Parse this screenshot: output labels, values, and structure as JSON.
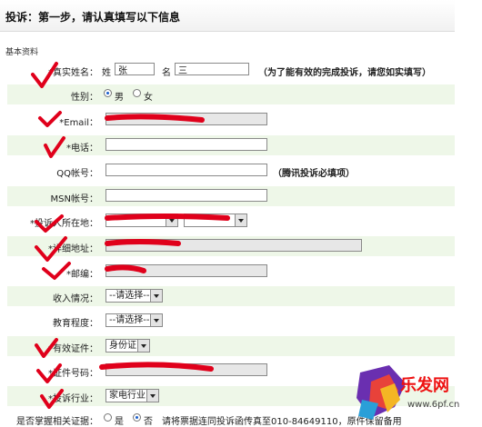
{
  "title": "投诉：第一步，请认真填写以下信息",
  "section": "基本资料",
  "rows": {
    "name": {
      "label": "*真实姓名：",
      "surname_label": "姓",
      "surname_value": "张",
      "given_label": "名",
      "given_value": "三",
      "hint": "（为了能有效的完成投诉，请您如实填写）"
    },
    "gender": {
      "label": "性别：",
      "male": "男",
      "female": "女",
      "selected": "男"
    },
    "email": {
      "label": "*Email：",
      "value": ""
    },
    "phone": {
      "label": "*电话：",
      "value": ""
    },
    "qq": {
      "label": "QQ帐号：",
      "value": "",
      "hint": "（腾讯投诉必填项）"
    },
    "msn": {
      "label": "MSN帐号：",
      "value": ""
    },
    "location": {
      "label": "*投诉人所在地："
    },
    "address": {
      "label": "*详细地址：",
      "value": ""
    },
    "zip": {
      "label": "*邮编：",
      "value": ""
    },
    "income": {
      "label": "收入情况：",
      "selected": "--请选择--"
    },
    "education": {
      "label": "教育程度：",
      "selected": "--请选择--"
    },
    "id_type": {
      "label": "*有效证件：",
      "selected": "身份证"
    },
    "id_number": {
      "label": "*证件号码：",
      "value": ""
    },
    "industry": {
      "label": "*投诉行业：",
      "selected": "家电行业"
    },
    "evidence": {
      "label": "是否掌握相关证据：",
      "yes": "是",
      "no": "否",
      "selected": "否",
      "note": "请将票据连同投诉函传真至010-84649110，原件保留备用"
    }
  },
  "watermark": {
    "brand": "乐发网",
    "url": "www.6pf.cn"
  },
  "colors": {
    "row_shade": "#eef7e8",
    "scribble": "#e0001b"
  }
}
